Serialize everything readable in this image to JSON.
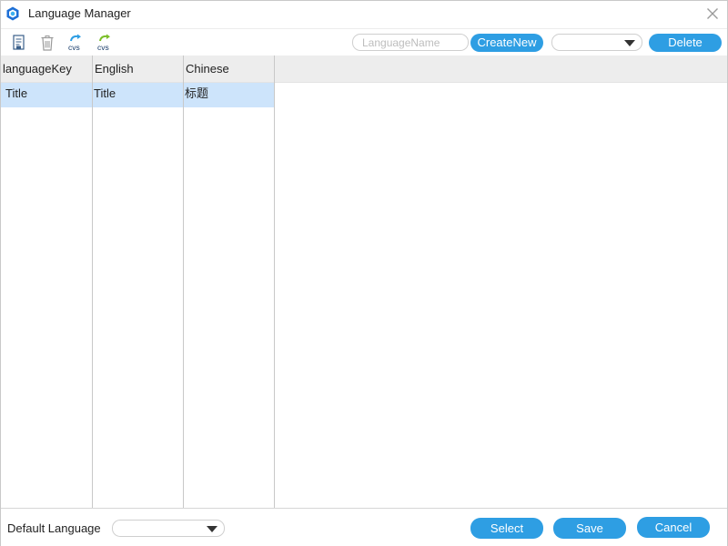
{
  "window": {
    "title": "Language Manager",
    "app_icon": "app-logo-icon",
    "close_icon": "close-icon"
  },
  "toolbar": {
    "icons": [
      "new-document-icon",
      "trash-icon",
      "csv-import-icon",
      "csv-export-icon"
    ],
    "csv_import_label": "cvs",
    "csv_export_label": "cvs",
    "language_name_placeholder": "LanguageName",
    "language_name_value": "",
    "create_new_label": "CreateNew",
    "language_select_value": "",
    "delete_label": "Delete"
  },
  "grid": {
    "columns": [
      "languageKey",
      "English",
      "Chinese"
    ],
    "rows": [
      {
        "languageKey": "Title",
        "English": "Title",
        "Chinese": "标题",
        "selected": true
      }
    ]
  },
  "footer": {
    "default_language_label": "Default Language",
    "default_language_value": "",
    "select_label": "Select",
    "save_label": "Save",
    "cancel_label": "Cancel"
  },
  "colors": {
    "accent": "#2e9ee3",
    "selected_row": "#cde4fb",
    "header_bg": "#ededed"
  }
}
